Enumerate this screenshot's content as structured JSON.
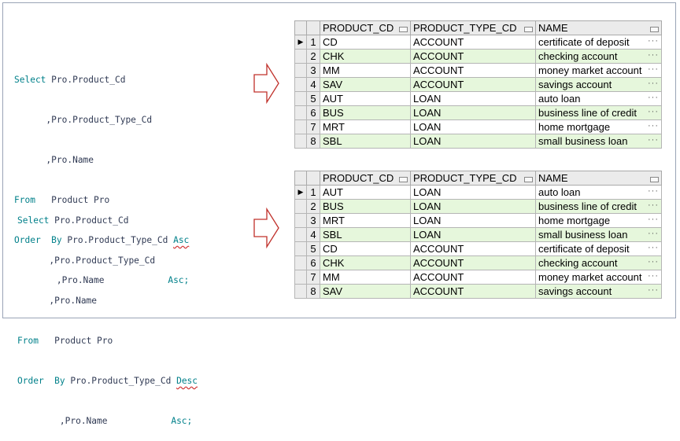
{
  "queries": [
    {
      "lines": [
        {
          "kw": "Select",
          "rest": " Pro.Product_Cd"
        },
        {
          "kw": "",
          "rest": "      ,Pro.Product_Type_Cd"
        },
        {
          "kw": "",
          "rest": "      ,Pro.Name"
        },
        {
          "kw": "From",
          "rest": "   Product Pro"
        },
        {
          "kw": "Order  By",
          "rest": " Pro.Product_Type_Cd ",
          "ord": "Asc"
        },
        {
          "kw": "",
          "rest": "        ,Pro.Name            ",
          "ord2": "Asc;"
        }
      ]
    },
    {
      "lines": [
        {
          "kw": "Select",
          "rest": " Pro.Product_Cd"
        },
        {
          "kw": "",
          "rest": "      ,Pro.Product_Type_Cd"
        },
        {
          "kw": "",
          "rest": "      ,Pro.Name"
        },
        {
          "kw": "From",
          "rest": "   Product Pro"
        },
        {
          "kw": "Order  By",
          "rest": " Pro.Product_Type_Cd ",
          "ord": "Desc"
        },
        {
          "kw": "",
          "rest": "        ,Pro.Name            ",
          "ord2": "Asc;"
        }
      ]
    }
  ],
  "columns": [
    "PRODUCT_CD",
    "PRODUCT_TYPE_CD",
    "NAME"
  ],
  "current_row_indicator": "▶",
  "cell_ellipsis": "···",
  "results": [
    {
      "rows": [
        [
          "1",
          "CD",
          "ACCOUNT",
          "certificate of deposit"
        ],
        [
          "2",
          "CHK",
          "ACCOUNT",
          "checking account"
        ],
        [
          "3",
          "MM",
          "ACCOUNT",
          "money market account"
        ],
        [
          "4",
          "SAV",
          "ACCOUNT",
          "savings account"
        ],
        [
          "5",
          "AUT",
          "LOAN",
          "auto loan"
        ],
        [
          "6",
          "BUS",
          "LOAN",
          "business line of credit"
        ],
        [
          "7",
          "MRT",
          "LOAN",
          "home mortgage"
        ],
        [
          "8",
          "SBL",
          "LOAN",
          "small business loan"
        ]
      ]
    },
    {
      "rows": [
        [
          "1",
          "AUT",
          "LOAN",
          "auto loan"
        ],
        [
          "2",
          "BUS",
          "LOAN",
          "business line of credit"
        ],
        [
          "3",
          "MRT",
          "LOAN",
          "home mortgage"
        ],
        [
          "4",
          "SBL",
          "LOAN",
          "small business loan"
        ],
        [
          "5",
          "CD",
          "ACCOUNT",
          "certificate of deposit"
        ],
        [
          "6",
          "CHK",
          "ACCOUNT",
          "checking account"
        ],
        [
          "7",
          "MM",
          "ACCOUNT",
          "money market account"
        ],
        [
          "8",
          "SAV",
          "ACCOUNT",
          "savings account"
        ]
      ]
    }
  ],
  "colors": {
    "keyword": "#00808a",
    "identifier": "#303a54",
    "arrow": "#c0302a",
    "even_row": "#e6f7dc",
    "header": "#ebebeb"
  }
}
